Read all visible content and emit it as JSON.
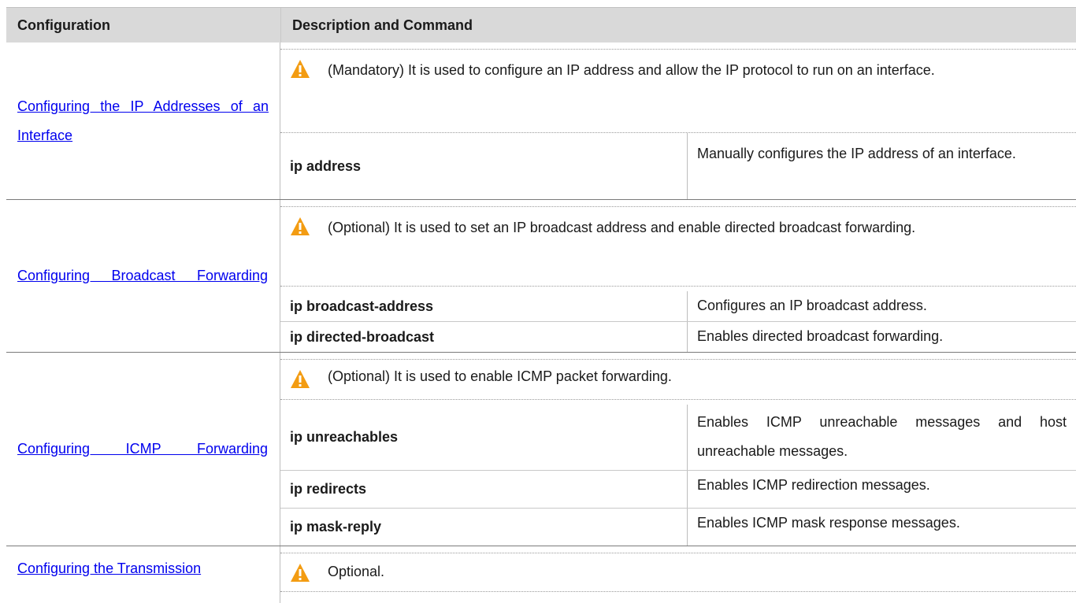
{
  "header": {
    "col1": "Configuration",
    "col2": "Description and Command"
  },
  "groups": [
    {
      "link": "Configuring the IP Addresses of an Interface",
      "note": "(Mandatory) It is used to configure an IP address and allow the IP protocol to run on an interface.",
      "rows": [
        {
          "command": "ip address",
          "description": "Manually configures the IP address of an interface."
        }
      ]
    },
    {
      "link": "Configuring Broadcast Forwarding",
      "note": "(Optional) It is used to set an IP broadcast address and enable directed broadcast forwarding.",
      "rows": [
        {
          "command": "ip broadcast-address",
          "description": "Configures an IP broadcast address."
        },
        {
          "command": "ip directed-broadcast",
          "description": "Enables directed broadcast forwarding."
        }
      ]
    },
    {
      "link": "Configuring ICMP Forwarding",
      "note": "(Optional) It is used to enable ICMP packet forwarding.",
      "rows": [
        {
          "command": "ip unreachables",
          "description": "Enables ICMP unreachable messages and host unreachable messages."
        },
        {
          "command": "ip redirects",
          "description": "Enables ICMP redirection messages."
        },
        {
          "command": "ip mask-reply",
          "description": "Enables ICMP mask response messages."
        }
      ]
    },
    {
      "link": "Configuring the Transmission",
      "note": "Optional.",
      "rows": []
    }
  ],
  "icons": {
    "warning": "warning-triangle-icon",
    "warning_color": "#f39c12"
  }
}
